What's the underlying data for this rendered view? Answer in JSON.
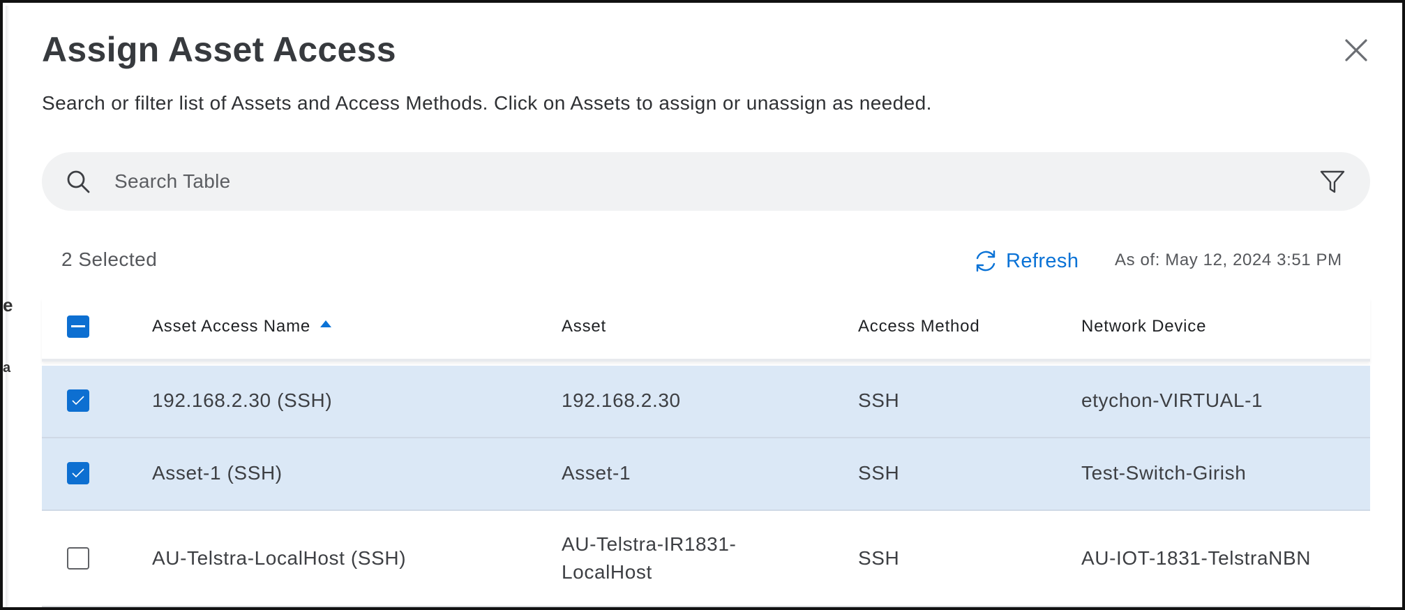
{
  "dialog": {
    "title": "Assign Asset Access",
    "subtitle": "Search or filter list of Assets and Access Methods. Click on Assets to assign or unassign as needed."
  },
  "search": {
    "placeholder": "Search Table",
    "value": ""
  },
  "toolbar": {
    "selected_count": "2 Selected",
    "refresh_label": "Refresh",
    "as_of": "As of: May 12, 2024 3:51 PM"
  },
  "table": {
    "columns": [
      "Asset Access Name",
      "Asset",
      "Access Method",
      "Network Device"
    ],
    "sort": {
      "column": "Asset Access Name",
      "direction": "ascending"
    },
    "header_checkbox_state": "indeterminate",
    "rows": [
      {
        "selected": true,
        "name": "192.168.2.30 (SSH)",
        "asset": "192.168.2.30",
        "method": "SSH",
        "device": "etychon-VIRTUAL-1"
      },
      {
        "selected": true,
        "name": "Asset-1 (SSH)",
        "asset": "Asset-1",
        "method": "SSH",
        "device": "Test-Switch-Girish"
      },
      {
        "selected": false,
        "name": "AU-Telstra-LocalHost (SSH)",
        "asset": "AU-Telstra-IR1831-LocalHost",
        "method": "SSH",
        "device": "AU-IOT-1831-TelstraNBN"
      }
    ]
  },
  "background_text": {
    "fragment_1": "e",
    "fragment_2": "a"
  },
  "icons": {
    "close": "close-icon",
    "search": "search-icon",
    "filter": "filter-icon",
    "refresh": "refresh-icon",
    "sort": "sort-ascending-icon",
    "checkbox_checked": "check-icon",
    "checkbox_indeterminate": "minus-icon"
  },
  "colors": {
    "accent": "#0a72d6",
    "selected_row": "#dbe8f6",
    "search_bg": "#f1f2f3",
    "title": "#373a3e"
  }
}
